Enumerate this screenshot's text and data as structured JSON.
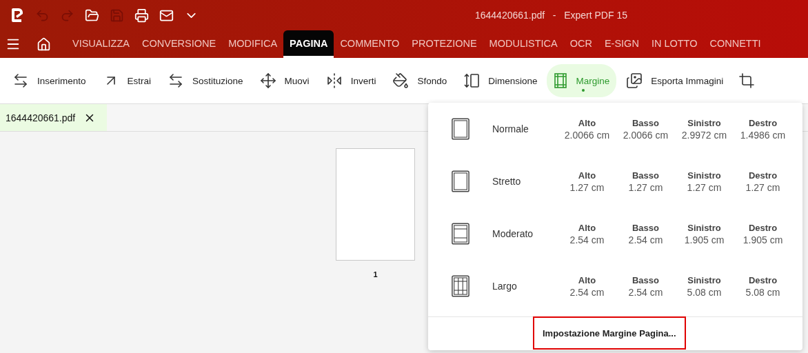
{
  "window": {
    "title": "1644420661.pdf   -   Expert PDF 15"
  },
  "quick_access": [
    {
      "disabled": true
    },
    {
      "disabled": true
    },
    {
      "disabled": false
    },
    {
      "disabled": true
    },
    {
      "disabled": false
    },
    {
      "disabled": false
    },
    {
      "disabled": false
    }
  ],
  "menu_tabs": [
    {
      "label": "VISUALIZZA",
      "selected": false
    },
    {
      "label": "CONVERSIONE",
      "selected": false
    },
    {
      "label": "MODIFICA",
      "selected": false
    },
    {
      "label": "PAGINA",
      "selected": true
    },
    {
      "label": "COMMENTO",
      "selected": false
    },
    {
      "label": "PROTEZIONE",
      "selected": false
    },
    {
      "label": "MODULISTICA",
      "selected": false
    },
    {
      "label": "OCR",
      "selected": false
    },
    {
      "label": "E-SIGN",
      "selected": false
    },
    {
      "label": "IN LOTTO",
      "selected": false
    },
    {
      "label": "CONNETTI",
      "selected": false
    }
  ],
  "toolbar": [
    {
      "label": "Inserimento",
      "selected": false
    },
    {
      "label": "Estrai",
      "selected": false
    },
    {
      "label": "Sostituzione",
      "selected": false
    },
    {
      "label": "Muovi",
      "selected": false
    },
    {
      "label": "Inverti",
      "selected": false
    },
    {
      "label": "Sfondo",
      "selected": false
    },
    {
      "label": "Dimensione",
      "selected": false
    },
    {
      "label": "Margine",
      "selected": true
    },
    {
      "label": "Esporta Immagini",
      "selected": false
    }
  ],
  "document_tabs": [
    {
      "label": "1644420661.pdf",
      "selected": true
    }
  ],
  "pages": [
    {
      "number": "1"
    }
  ],
  "margin_menu": {
    "presets": [
      {
        "name": "Normale",
        "values": [
          {
            "label": "Alto",
            "value": "2.0066 cm"
          },
          {
            "label": "Basso",
            "value": "2.0066 cm"
          },
          {
            "label": "Sinistro",
            "value": "2.9972 cm"
          },
          {
            "label": "Destro",
            "value": "1.4986 cm"
          }
        ]
      },
      {
        "name": "Stretto",
        "values": [
          {
            "label": "Alto",
            "value": "1.27 cm"
          },
          {
            "label": "Basso",
            "value": "1.27 cm"
          },
          {
            "label": "Sinistro",
            "value": "1.27 cm"
          },
          {
            "label": "Destro",
            "value": "1.27 cm"
          }
        ]
      },
      {
        "name": "Moderato",
        "values": [
          {
            "label": "Alto",
            "value": "2.54 cm"
          },
          {
            "label": "Basso",
            "value": "2.54 cm"
          },
          {
            "label": "Sinistro",
            "value": "1.905 cm"
          },
          {
            "label": "Destro",
            "value": "1.905 cm"
          }
        ]
      },
      {
        "name": "Largo",
        "values": [
          {
            "label": "Alto",
            "value": "2.54 cm"
          },
          {
            "label": "Basso",
            "value": "2.54 cm"
          },
          {
            "label": "Sinistro",
            "value": "5.08 cm"
          },
          {
            "label": "Destro",
            "value": "5.08 cm"
          }
        ]
      }
    ],
    "footer_button": {
      "label": "Impostazione Margine Pagina..."
    }
  }
}
